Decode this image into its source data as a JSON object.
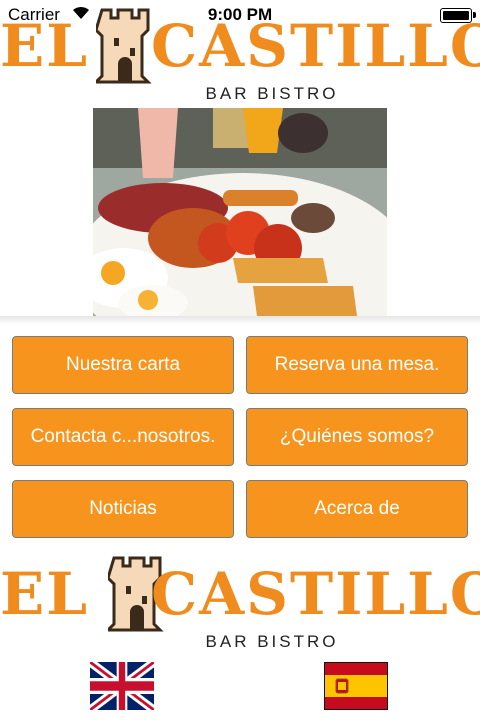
{
  "status_bar": {
    "carrier": "Carrier",
    "time": "9:00 PM"
  },
  "brand": {
    "name": "EL CASTILLO",
    "tagline": "BAR BISTRO",
    "accent_color": "#f7941e"
  },
  "menu": {
    "buttons": [
      {
        "label": "Nuestra carta"
      },
      {
        "label": "Reserva una mesa."
      },
      {
        "label": "Contacta c...nosotros."
      },
      {
        "label": "¿Quiénes somos?"
      },
      {
        "label": "Noticias"
      },
      {
        "label": "Acerca de"
      }
    ]
  },
  "languages": [
    {
      "icon": "uk-flag-icon"
    },
    {
      "icon": "spain-flag-icon"
    }
  ]
}
